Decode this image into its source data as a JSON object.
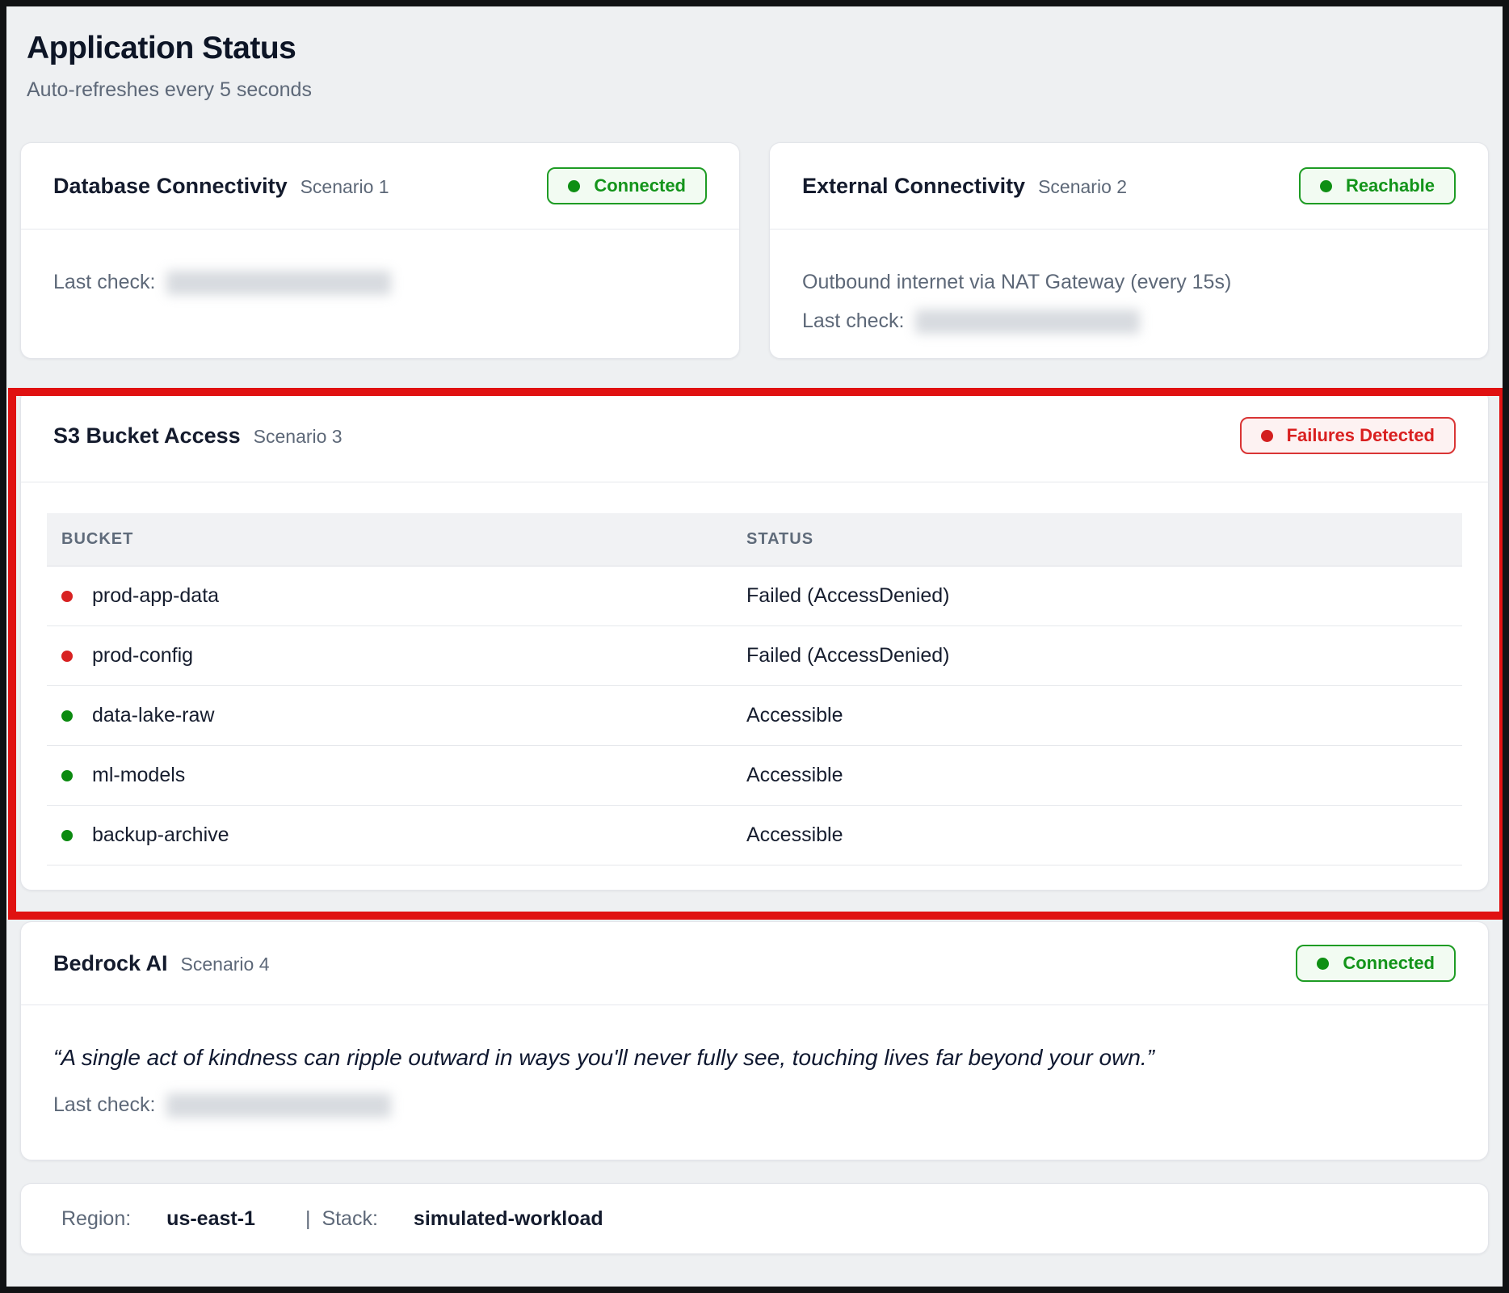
{
  "page": {
    "title": "Application Status",
    "subtitle": "Auto-refreshes every 5 seconds"
  },
  "cards": {
    "database": {
      "title": "Database Connectivity",
      "scenario": "Scenario 1",
      "badge": "Connected",
      "badge_state": "ok",
      "last_check_label": "Last check:"
    },
    "external": {
      "title": "External Connectivity",
      "scenario": "Scenario 2",
      "badge": "Reachable",
      "badge_state": "ok",
      "description": "Outbound internet via NAT Gateway (every 15s)",
      "last_check_label": "Last check:"
    },
    "s3": {
      "title": "S3 Bucket Access",
      "scenario": "Scenario 3",
      "badge": "Failures Detected",
      "badge_state": "err",
      "table": {
        "headers": [
          "BUCKET",
          "STATUS"
        ],
        "rows": [
          {
            "bucket": "prod-app-data",
            "status": "Failed (AccessDenied)",
            "state": "err"
          },
          {
            "bucket": "prod-config",
            "status": "Failed (AccessDenied)",
            "state": "err"
          },
          {
            "bucket": "data-lake-raw",
            "status": "Accessible",
            "state": "ok"
          },
          {
            "bucket": "ml-models",
            "status": "Accessible",
            "state": "ok"
          },
          {
            "bucket": "backup-archive",
            "status": "Accessible",
            "state": "ok"
          }
        ]
      }
    },
    "bedrock": {
      "title": "Bedrock AI",
      "scenario": "Scenario 4",
      "badge": "Connected",
      "badge_state": "ok",
      "quote": "“A single act of kindness can ripple outward in ways you'll never fully see, touching lives far beyond your own.”",
      "last_check_label": "Last check:"
    }
  },
  "footer": {
    "region_label": "Region:",
    "region_value": "us-east-1",
    "separator": "|",
    "stack_label": "Stack:",
    "stack_value": "simulated-workload"
  },
  "colors": {
    "status_ok_green": "#13941a",
    "status_err_red": "#d91f1f",
    "annotation_red": "#e01111",
    "page_background": "#eef0f2",
    "card_background": "#ffffff"
  }
}
